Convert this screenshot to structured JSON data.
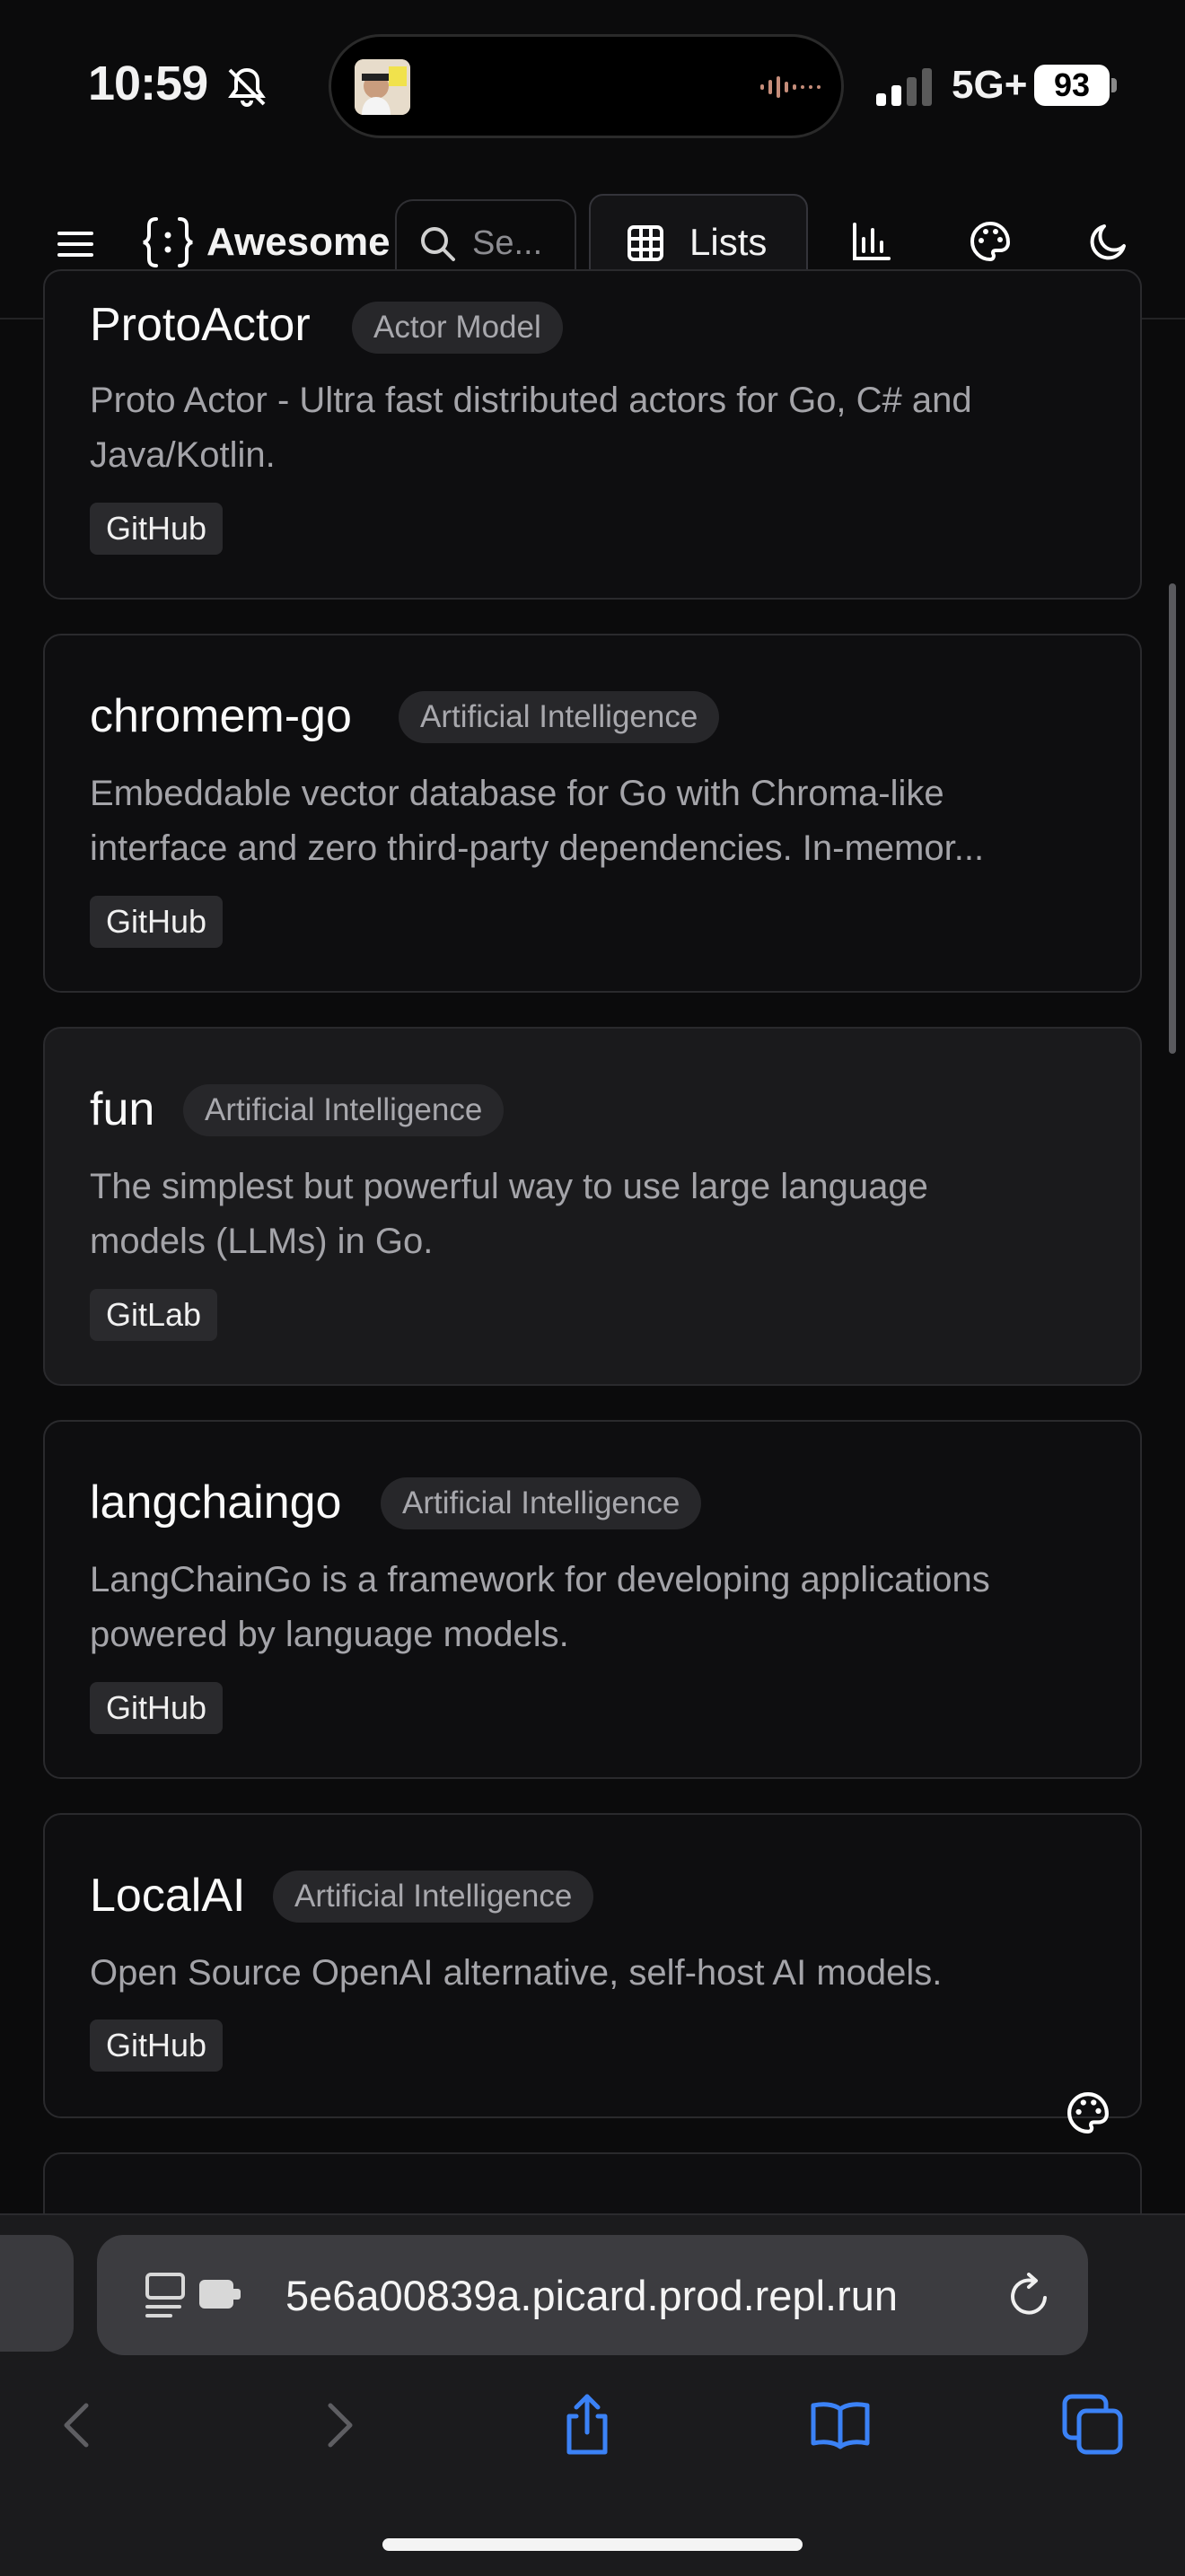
{
  "status": {
    "time": "10:59",
    "network": "5G+",
    "battery": "93"
  },
  "nav": {
    "brand": "Awesome",
    "search_placeholder": "Se...",
    "lists_label": "Lists"
  },
  "cards": [
    {
      "title": "ProtoActor",
      "category": "Actor Model",
      "description_line1": "Proto Actor - Ultra fast distributed actors for Go, C# and",
      "description_line2": "Java/Kotlin.",
      "source": "GitHub"
    },
    {
      "title": "chromem-go",
      "category": "Artificial Intelligence",
      "description_line1": "Embeddable vector database for Go with Chroma-like",
      "description_line2": "interface and zero third-party dependencies. In-memor...",
      "source": "GitHub"
    },
    {
      "title": "fun",
      "category": "Artificial Intelligence",
      "description_line1": "The simplest but powerful way to use large language",
      "description_line2": "models (LLMs) in Go.",
      "source": "GitLab"
    },
    {
      "title": "langchaingo",
      "category": "Artificial Intelligence",
      "description_line1": "LangChainGo is a framework for developing applications",
      "description_line2": "powered by language models.",
      "source": "GitHub"
    },
    {
      "title": "LocalAI",
      "category": "Artificial Intelligence",
      "description_line1": "Open Source OpenAI alternative, self-host AI models.",
      "source": "GitHub"
    }
  ],
  "browser": {
    "url": "5e6a00839a.picard.prod.repl.run"
  },
  "icons": {
    "menu": "hamburger-icon",
    "brand": "code-braces-icon",
    "search": "search-icon",
    "lists": "grid-table-icon",
    "stats": "bar-chart-icon",
    "theme": "palette-icon",
    "dark_mode": "moon-icon",
    "reload": "reload-icon",
    "share": "share-icon",
    "bookmarks": "book-icon",
    "tabs": "tabs-icon"
  },
  "colors": {
    "background": "#0b0b0c",
    "card_border": "#2a2a2d",
    "accent_blue": "#3b82f6"
  }
}
